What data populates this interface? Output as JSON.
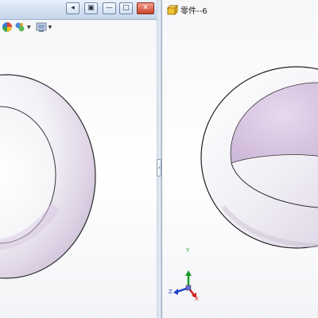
{
  "left_window": {
    "buttons": {
      "restore_prev": "◂",
      "tile": "▣",
      "minimize": "—",
      "maximize": "□",
      "close": "✕"
    },
    "toolbar": {
      "icons": [
        "appearance-icon",
        "scene-icon",
        "display-settings-icon"
      ]
    }
  },
  "right_window": {
    "title": "零件--6",
    "doc_icon": "part-icon"
  },
  "triad": {
    "x_label": "X",
    "y_label": "Y",
    "z_label": "Z"
  },
  "splitter": {
    "grip_label": "‹›"
  },
  "colors": {
    "titlebar": "#d4e1f2",
    "ring_base": "#f4f4f8",
    "ring_tint": "#d9c8e0",
    "x_axis": "#d11f1f",
    "y_axis": "#1a9c2b",
    "z_axis": "#1f3fd1"
  }
}
